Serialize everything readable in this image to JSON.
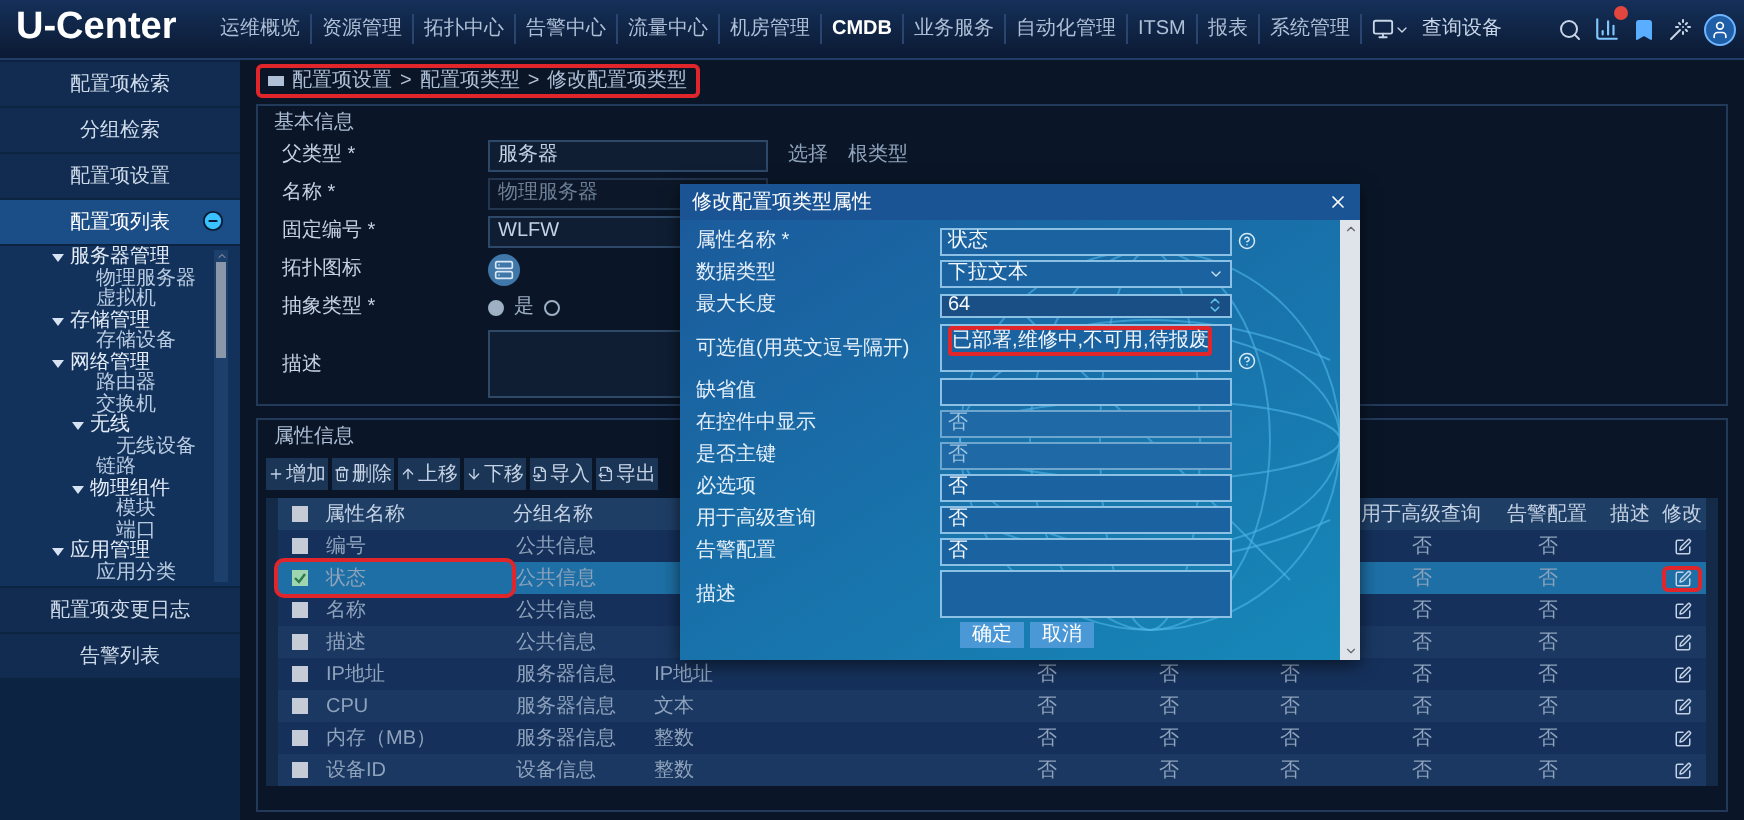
{
  "app": {
    "logo": "U-Center"
  },
  "nav": [
    {
      "label": "运维概览",
      "selected": false
    },
    {
      "label": "资源管理",
      "selected": false
    },
    {
      "label": "拓扑中心",
      "selected": false
    },
    {
      "label": "告警中心",
      "selected": false
    },
    {
      "label": "流量中心",
      "selected": false
    },
    {
      "label": "机房管理",
      "selected": false
    },
    {
      "label": "CMDB",
      "selected": true
    },
    {
      "label": "业务服务",
      "selected": false
    },
    {
      "label": "自动化管理",
      "selected": false
    },
    {
      "label": "ITSM",
      "selected": false
    },
    {
      "label": "报表",
      "selected": false
    },
    {
      "label": "系统管理",
      "selected": false
    }
  ],
  "search": {
    "placeholder": "查询设备"
  },
  "sidebar": {
    "items": [
      {
        "label": "配置项检索",
        "selected": false
      },
      {
        "label": "分组检索",
        "selected": false
      },
      {
        "label": "配置项设置",
        "selected": false
      },
      {
        "label": "配置项列表",
        "selected": true,
        "expanded": true,
        "tree": [
          {
            "label": "服务器管理",
            "expanded": true,
            "children": [
              {
                "label": "物理服务器"
              },
              {
                "label": "虚拟机"
              }
            ]
          },
          {
            "label": "存储管理",
            "expanded": true,
            "children": [
              {
                "label": "存储设备"
              }
            ]
          },
          {
            "label": "网络管理",
            "expanded": true,
            "children": [
              {
                "label": "路由器"
              },
              {
                "label": "交换机"
              },
              {
                "label": "无线",
                "expanded": true,
                "children": [
                  {
                    "label": "无线设备"
                  }
                ]
              },
              {
                "label": "链路"
              },
              {
                "label": "物理组件",
                "expanded": true,
                "children": [
                  {
                    "label": "模块"
                  },
                  {
                    "label": "端口"
                  }
                ]
              }
            ]
          },
          {
            "label": "应用管理",
            "expanded": true,
            "children": [
              {
                "label": "应用分类"
              }
            ]
          }
        ]
      },
      {
        "label": "配置项变更日志",
        "selected": false
      },
      {
        "label": "告警列表",
        "selected": false
      }
    ]
  },
  "breadcrumb": {
    "annotated": true,
    "separator": ">",
    "items": [
      "配置项设置",
      "配置项类型",
      "修改配置项类型"
    ]
  },
  "basic_info": {
    "title": "基本信息",
    "fields": [
      {
        "kind": "text",
        "label": "父类型 *",
        "value": "服务器",
        "actions": [
          "选择",
          "根类型"
        ]
      },
      {
        "kind": "text",
        "label": "名称 *",
        "value": "物理服务器",
        "disabled": true
      },
      {
        "kind": "text",
        "label": "固定编号 *",
        "value": "WLFW",
        "disabled": false
      },
      {
        "kind": "icon",
        "label": "拓扑图标"
      },
      {
        "kind": "radio",
        "label": "抽象类型 *",
        "options": [
          {
            "label": "是",
            "selected": true
          },
          {
            "selected": false
          }
        ]
      },
      {
        "kind": "textarea",
        "label": "描述"
      }
    ]
  },
  "attributes": {
    "title": "属性信息",
    "toolbar": [
      {
        "kind": "add",
        "label": "增加"
      },
      {
        "kind": "delete",
        "label": "删除"
      },
      {
        "kind": "up",
        "label": "上移"
      },
      {
        "kind": "down",
        "label": "下移"
      },
      {
        "kind": "import",
        "label": "导入"
      },
      {
        "kind": "export",
        "label": "导出"
      }
    ],
    "header_checked": false,
    "columns": [
      {
        "label": "属性名称"
      },
      {
        "label": "分组名称"
      },
      {},
      {},
      {},
      {},
      {
        "label": "用于高级查询"
      },
      {
        "label": "告警配置"
      },
      {
        "label": "描述"
      },
      {
        "label": "修改"
      }
    ],
    "rows": [
      {
        "checked": false,
        "selected": false,
        "annotated": false,
        "edit_annotated": false,
        "cells": [
          "编号",
          "公共信息",
          null,
          null,
          null,
          null,
          "否",
          "否",
          null
        ]
      },
      {
        "checked": true,
        "selected": true,
        "annotated": true,
        "edit_annotated": true,
        "cells": [
          "状态",
          "公共信息",
          null,
          null,
          null,
          null,
          "否",
          "否",
          null
        ]
      },
      {
        "checked": false,
        "selected": false,
        "annotated": false,
        "edit_annotated": false,
        "cells": [
          "名称",
          "公共信息",
          null,
          null,
          null,
          null,
          "否",
          "否",
          null
        ]
      },
      {
        "checked": false,
        "selected": false,
        "annotated": false,
        "edit_annotated": false,
        "cells": [
          "描述",
          "公共信息",
          null,
          null,
          null,
          null,
          "否",
          "否",
          null
        ]
      },
      {
        "checked": false,
        "selected": false,
        "annotated": false,
        "edit_annotated": false,
        "cells": [
          "IP地址",
          "服务器信息",
          "IP地址",
          "否",
          "否",
          "否",
          "否",
          "否",
          null
        ]
      },
      {
        "checked": false,
        "selected": false,
        "annotated": false,
        "edit_annotated": false,
        "cells": [
          "CPU",
          "服务器信息",
          "文本",
          "否",
          "否",
          "否",
          "否",
          "否",
          null
        ]
      },
      {
        "checked": false,
        "selected": false,
        "annotated": false,
        "edit_annotated": false,
        "cells": [
          "内存（MB）",
          "服务器信息",
          "整数",
          "否",
          "否",
          "否",
          "否",
          "否",
          null
        ]
      },
      {
        "checked": false,
        "selected": false,
        "annotated": false,
        "edit_annotated": false,
        "cells": [
          "设备ID",
          "设备信息",
          "整数",
          "否",
          "否",
          "否",
          "否",
          "否",
          null
        ]
      }
    ]
  },
  "modal": {
    "title": "修改配置项类型属性",
    "fields": [
      {
        "kind": "text",
        "label": "属性名称 *",
        "value": "状态",
        "help": true,
        "disabled": false
      },
      {
        "kind": "select",
        "label": "数据类型",
        "value": "下拉文本"
      },
      {
        "kind": "number",
        "label": "最大长度",
        "value": "64"
      },
      {
        "kind": "textarea",
        "label": "可选值(用英文逗号隔开)",
        "value": "已部署,维修中,不可用,待报废",
        "help": true,
        "annotated": true
      },
      {
        "kind": "text",
        "label": "缺省值",
        "disabled": false
      },
      {
        "kind": "text",
        "label": "在控件中显示",
        "value": "否",
        "disabled": true
      },
      {
        "kind": "text",
        "label": "是否主键",
        "value": "否",
        "disabled": true
      },
      {
        "kind": "text",
        "label": "必选项",
        "value": "否",
        "disabled": false
      },
      {
        "kind": "text",
        "label": "用于高级查询",
        "value": "否",
        "disabled": false
      },
      {
        "kind": "text",
        "label": "告警配置",
        "value": "否",
        "disabled": false
      },
      {
        "kind": "textarea",
        "label": "描述"
      }
    ],
    "buttons": [
      "确定",
      "取消"
    ]
  }
}
